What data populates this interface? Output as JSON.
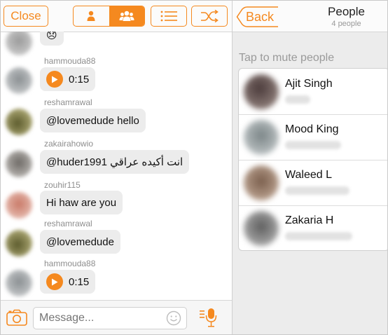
{
  "chat": {
    "close_label": "Close",
    "messages": [
      {
        "username": "",
        "kind": "emoji",
        "text": "😞"
      },
      {
        "username": "hammouda88",
        "kind": "voice",
        "text": "0:15"
      },
      {
        "username": "reshamrawal",
        "kind": "text",
        "text": "@lovemedude  hello"
      },
      {
        "username": "zakairahowio",
        "kind": "text",
        "text": "@huder1991 انت أكيده عراقي"
      },
      {
        "username": "zouhir115",
        "kind": "text",
        "text": "Hi haw are you"
      },
      {
        "username": "reshamrawal",
        "kind": "text",
        "text": "@lovemedude"
      },
      {
        "username": "hammouda88",
        "kind": "voice",
        "text": "0:15"
      }
    ],
    "input_placeholder": "Message..."
  },
  "people_panel": {
    "back_label": "Back",
    "title": "People",
    "count_label": "4 people",
    "hint": "Tap to mute people",
    "people": [
      {
        "name": "Ajit Singh"
      },
      {
        "name": "Mood King"
      },
      {
        "name": "Waleed L"
      },
      {
        "name": "Zakaria H"
      }
    ]
  },
  "colors": {
    "accent": "#f5891f",
    "bubble": "#ececec",
    "panel_bg": "#ececec"
  },
  "icons": [
    "person-icon",
    "group-icon",
    "list-icon",
    "shuffle-icon",
    "play-icon",
    "camera-icon",
    "emoji-icon",
    "mic-icon",
    "back-chevron-icon"
  ]
}
